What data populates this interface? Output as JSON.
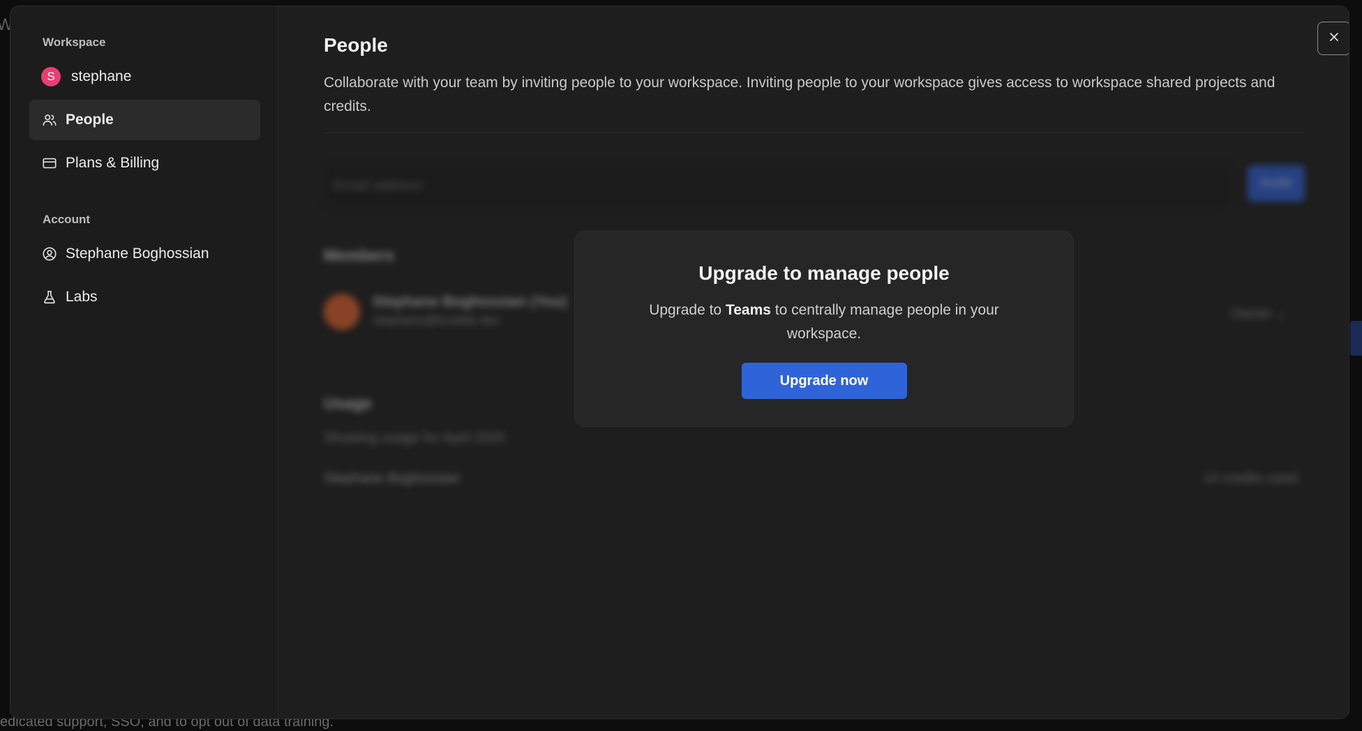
{
  "backdrop": {
    "top_fragment": "W",
    "bottom_text": "edicated support, SSO, and to opt out of data training."
  },
  "sidebar": {
    "workspace_section": "Workspace",
    "workspace_name": "stephane",
    "workspace_avatar_letter": "S",
    "items": [
      {
        "label": "People",
        "icon": "people-icon",
        "active": true
      },
      {
        "label": "Plans & Billing",
        "icon": "credit-card-icon",
        "active": false
      }
    ],
    "account_section": "Account",
    "account_items": [
      {
        "label": "Stephane Boghossian",
        "icon": "user-circle-icon"
      },
      {
        "label": "Labs",
        "icon": "flask-icon"
      }
    ]
  },
  "main": {
    "title": "People",
    "description": "Collaborate with your team by inviting people to your workspace. Inviting people to your workspace gives access to workspace shared projects and credits.",
    "invite": {
      "placeholder": "Email address",
      "button_label": "Invite"
    },
    "members_heading": "Members",
    "member": {
      "name": "Stephane Boghossian (You)",
      "email": "stephane@lovable.dev",
      "role": "Owner"
    },
    "usage_heading": "Usage",
    "usage_subtitle": "Showing usage for April 2025",
    "usage_row": {
      "name": "Stephane Boghossian",
      "credits": "14 credits used"
    }
  },
  "upgrade": {
    "title": "Upgrade to manage people",
    "body_prefix": "Upgrade to ",
    "body_plan": "Teams",
    "body_suffix": " to centrally manage people in your workspace.",
    "button_label": "Upgrade now"
  },
  "colors": {
    "accent": "#2f63d8",
    "workspace_avatar": "#e83e73",
    "member_avatar": "#e3622e"
  }
}
